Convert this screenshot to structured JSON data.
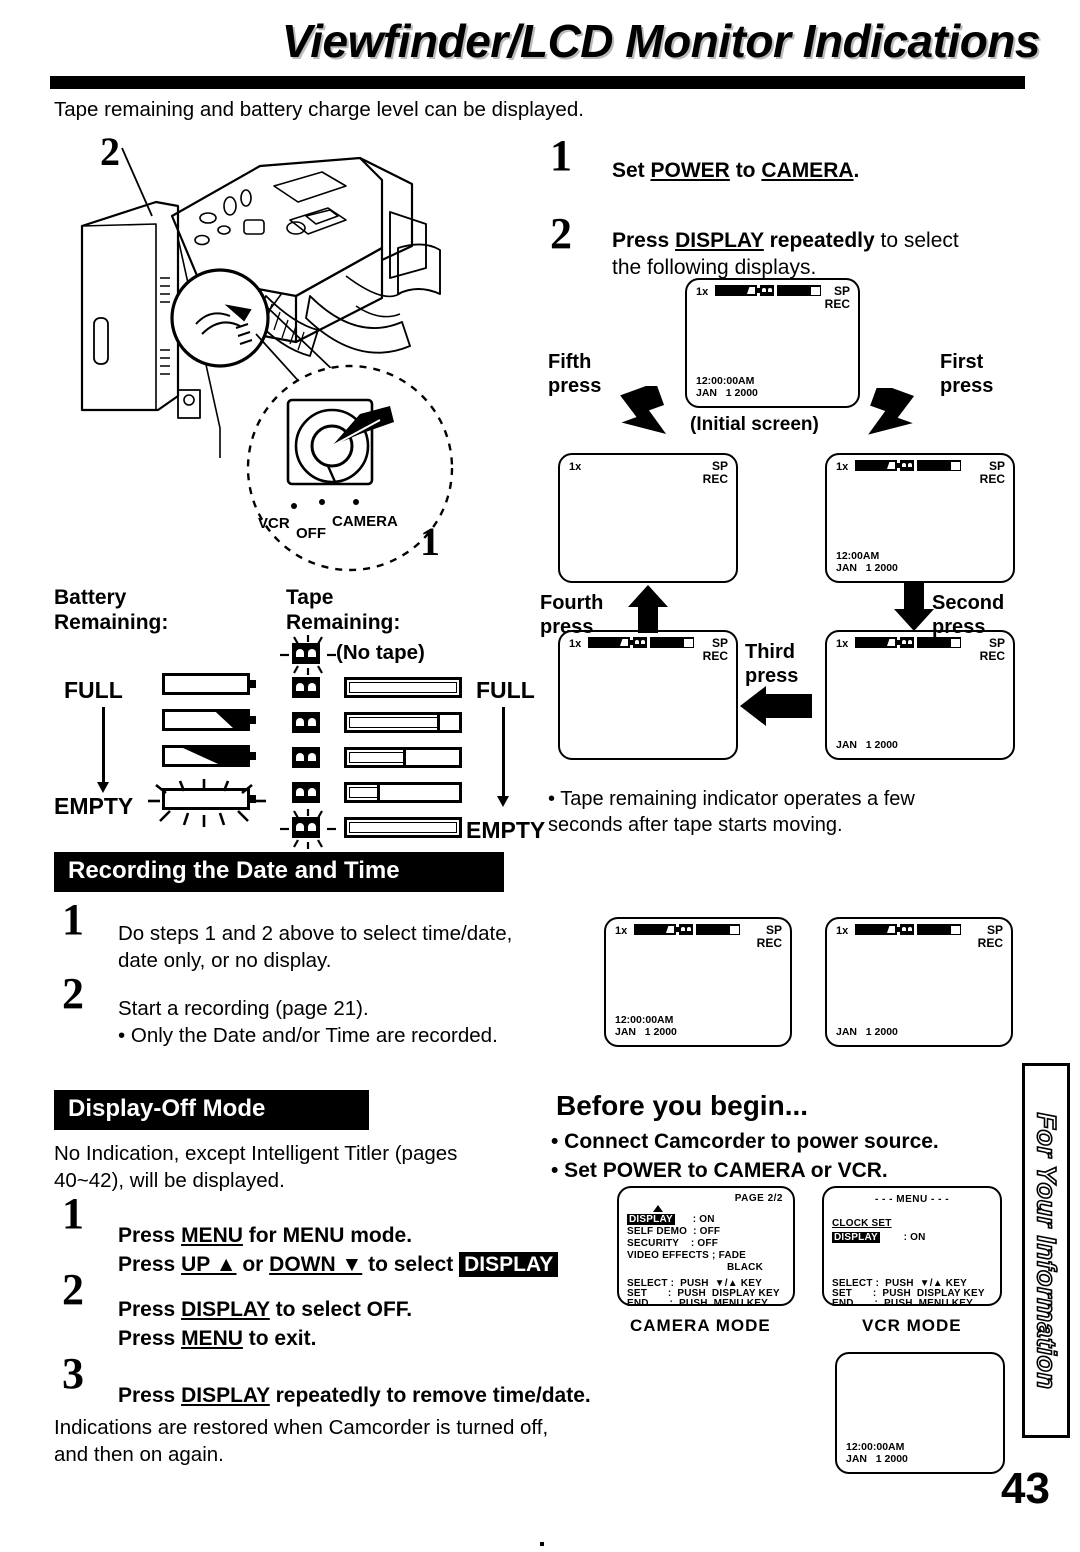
{
  "header": {
    "title": "Viewfinder/LCD Monitor Indications",
    "lead": "Tape remaining and battery charge level can be displayed."
  },
  "illustration": {
    "callout_2": "2",
    "callout_1": "1",
    "dial_labels": {
      "vcr": "VCR",
      "off": "OFF",
      "camera": "CAMERA"
    }
  },
  "steps_main": [
    {
      "num": "1",
      "line1_pre": "Set ",
      "line1_u": "POWER",
      "line1_mid": " to ",
      "line1_u2": "CAMERA",
      "line1_post": "."
    },
    {
      "num": "2",
      "line1_pre": "Press ",
      "line1_u": "DISPLAY",
      "line1_post": " repeatedly",
      "line1_reg": " to select",
      "line2": "the following displays."
    }
  ],
  "cycle": {
    "initial_caption": "(Initial screen)",
    "labels": {
      "first": "First\npress",
      "second": "Second\npress",
      "third": "Third\npress",
      "fourth": "Fourth\npress",
      "fifth": "Fifth\npress"
    },
    "screens": {
      "initial": {
        "zoom": "1x",
        "mode": "SP\nREC",
        "stamp": "12:00:00AM\nJAN   1 2000",
        "gauges": true
      },
      "first": {
        "zoom": "1x",
        "mode": "SP\nREC",
        "stamp": "12:00AM\nJAN   1 2000",
        "gauges": true
      },
      "second": {
        "zoom": "1x",
        "mode": "SP\nREC",
        "stamp": "JAN   1 2000",
        "gauges": true
      },
      "third": {
        "zoom": "1x",
        "mode": "SP\nREC",
        "stamp": "",
        "gauges": true
      },
      "fourth": {
        "zoom": "1x",
        "mode": "SP\nREC",
        "stamp": "",
        "gauges": false
      }
    },
    "note": "• Tape remaining indicator operates a few\n   seconds after tape starts moving."
  },
  "legend": {
    "battery_heading": "Battery\nRemaining:",
    "tape_heading": "Tape\nRemaining:",
    "battery_full": "FULL",
    "battery_empty": "EMPTY",
    "tape_full": "FULL",
    "tape_empty": "EMPTY",
    "no_tape": "(No tape)"
  },
  "section_recording": {
    "title": "Recording the Date and Time",
    "steps": [
      {
        "num": "1",
        "line1": "Do steps 1 and 2 above to select time/date,",
        "line2": "date only, or no display."
      },
      {
        "num": "2",
        "line1": "Start a recording (page 21).",
        "line2": "• Only the Date and/or Time are recorded."
      }
    ],
    "screens": {
      "left": {
        "zoom": "1x",
        "mode": "SP\nREC",
        "stamp": "12:00:00AM\nJAN   1 2000"
      },
      "right": {
        "zoom": "1x",
        "mode": "SP\nREC",
        "stamp": "JAN   1 2000"
      }
    }
  },
  "section_display_off": {
    "title": "Display-Off Mode",
    "intro": "No Indication, except Intelligent Titler (pages\n40~42), will be displayed.",
    "steps": [
      {
        "num": "1",
        "l1_pre": "Press ",
        "l1_u": "MENU",
        "l1_post": " for MENU mode.",
        "l2_pre": "Press ",
        "l2_u": "UP ▲",
        "l2_mid": " or ",
        "l2_u2": "DOWN ▼",
        "l2_post": " to select ",
        "l2_badge": "DISPLAY"
      },
      {
        "num": "2",
        "l1_pre": "Press ",
        "l1_u": "DISPLAY",
        "l1_post": " to select OFF.",
        "l2_pre": "Press ",
        "l2_u": "MENU",
        "l2_post": " to exit."
      },
      {
        "num": "3",
        "l1_pre": "Press ",
        "l1_u": "DISPLAY",
        "l1_post": " repeatedly to remove time/date."
      }
    ],
    "footer": "Indications are restored when Camcorder is turned off,\nand then on again."
  },
  "before_you_begin": {
    "title": "Before you begin...",
    "bullets": [
      "• Connect Camcorder to power source.",
      "• Set POWER to CAMERA or VCR."
    ]
  },
  "menus": {
    "camera": {
      "page": "PAGE  2/2",
      "rows": [
        {
          "label": "DISPLAY",
          "sep": ":",
          "value": "ON",
          "selected": true
        },
        {
          "label": "SELF DEMO",
          "sep": ":",
          "value": "OFF",
          "selected": false
        },
        {
          "label": "SECURITY",
          "sep": ":",
          "value": "OFF",
          "selected": false
        },
        {
          "label": "VIDEO EFFECTS",
          "sep": ";",
          "value": "FADE",
          "selected": false
        },
        {
          "label": "",
          "sep": "",
          "value": "BLACK",
          "selected": false
        }
      ],
      "help": [
        "SELECT :  PUSH  ▼/▲ KEY",
        "SET       :  PUSH  DISPLAY KEY",
        "END       :  PUSH  MENU KEY"
      ],
      "mode_label": "CAMERA  MODE"
    },
    "vcr": {
      "title": "- - -  MENU  - - -",
      "rows": [
        {
          "label": "CLOCK SET",
          "sep": "",
          "value": "",
          "selected": false,
          "underline": true
        },
        {
          "label": "DISPLAY",
          "sep": ":",
          "value": "ON",
          "selected": true
        }
      ],
      "help": [
        "SELECT :  PUSH  ▼/▲ KEY",
        "SET       :  PUSH  DISPLAY KEY",
        "END       :  PUSH  MENU KEY"
      ],
      "mode_label": "VCR  MODE"
    },
    "blank_screen": {
      "stamp": "12:00:00AM\nJAN   1 2000"
    }
  },
  "side_tab": {
    "label": "For Your Information"
  },
  "page_number": "43"
}
